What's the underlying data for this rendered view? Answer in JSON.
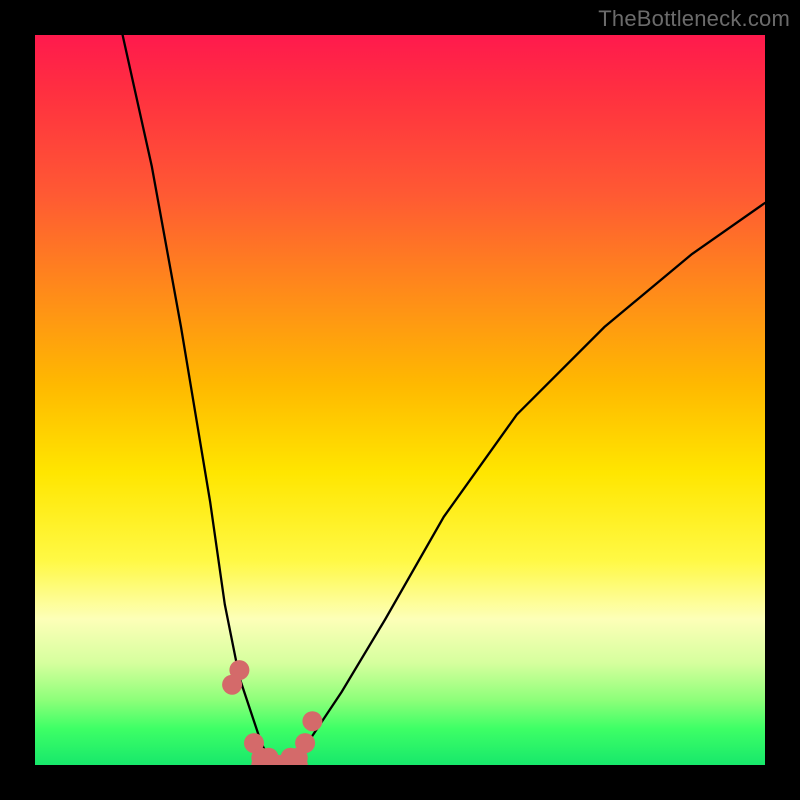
{
  "watermark": "TheBottleneck.com",
  "chart_data": {
    "type": "line",
    "title": "",
    "xlabel": "",
    "ylabel": "",
    "xlim": [
      0,
      100
    ],
    "ylim": [
      0,
      100
    ],
    "grid": false,
    "series": [
      {
        "name": "bottleneck-curve",
        "color": "#000000",
        "x": [
          12,
          16,
          20,
          24,
          26,
          28,
          30,
          31,
          32,
          33,
          34,
          35,
          38,
          42,
          48,
          56,
          66,
          78,
          90,
          100
        ],
        "y": [
          100,
          82,
          60,
          36,
          22,
          12,
          6,
          3,
          1,
          0,
          0,
          1,
          4,
          10,
          20,
          34,
          48,
          60,
          70,
          77
        ]
      },
      {
        "name": "bottom-marker-band",
        "color": "#d46a6a",
        "x": [
          27,
          28,
          30,
          31,
          32,
          33,
          34,
          35,
          36,
          37,
          38
        ],
        "y": [
          11,
          13,
          3,
          1,
          1,
          0,
          0,
          1,
          1,
          3,
          6
        ]
      }
    ],
    "background_gradient": {
      "top": "#ff1a4d",
      "mid": "#ffe600",
      "bottom": "#17e86b"
    }
  }
}
